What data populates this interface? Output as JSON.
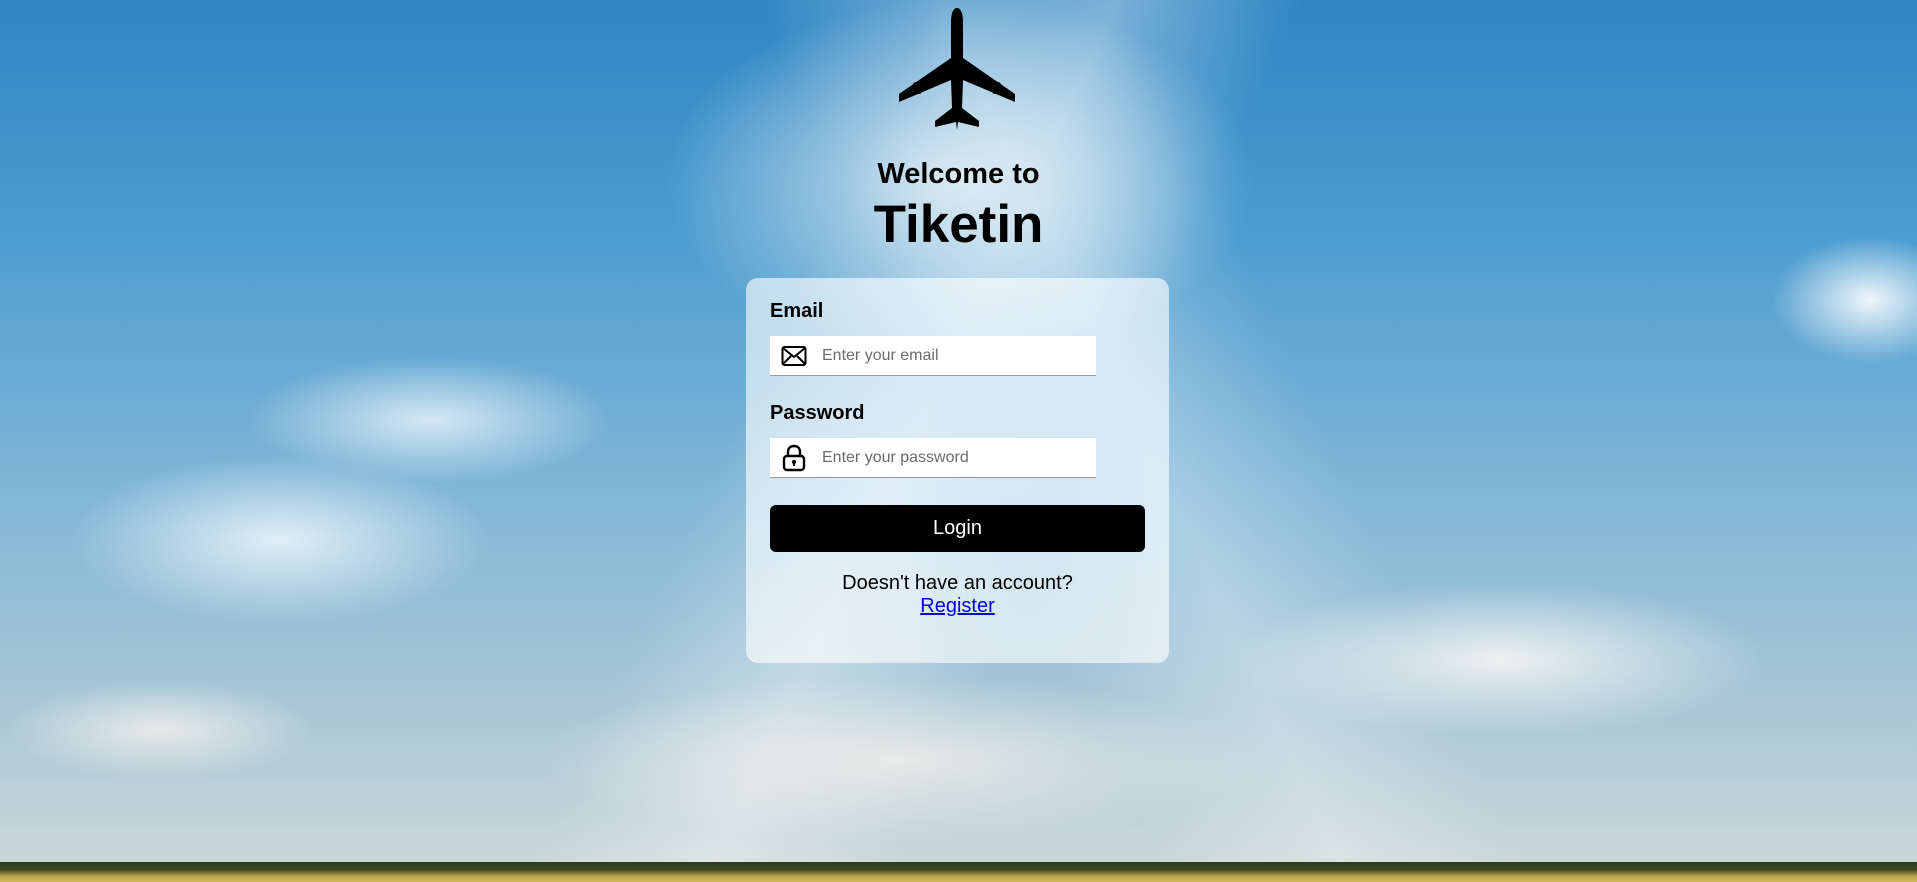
{
  "header": {
    "logo_icon": "airplane-icon",
    "welcome": "Welcome to",
    "brand": "Tiketin"
  },
  "form": {
    "email": {
      "label": "Email",
      "placeholder": "Enter your email",
      "value": "",
      "icon": "envelope-icon"
    },
    "password": {
      "label": "Password",
      "placeholder": "Enter your password",
      "value": "",
      "icon": "lock-icon"
    },
    "login_label": "Login",
    "no_account_text": "Doesn't have an account?",
    "register_label": "Register"
  },
  "colors": {
    "button": "#000000",
    "link": "#0000ee"
  }
}
